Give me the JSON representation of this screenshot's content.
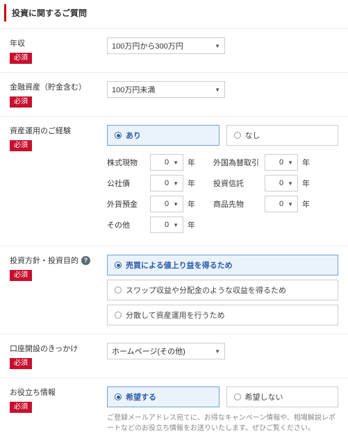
{
  "section_title": "投資に関するご質問",
  "required_label": "必須",
  "year_unit": "年",
  "annual_income": {
    "label": "年収",
    "value": "100万円から300万円"
  },
  "financial_assets": {
    "label": "金融資産（貯金含む）",
    "value": "100万円未満"
  },
  "experience": {
    "label": "資産運用のご経験",
    "option_yes": "あり",
    "option_no": "なし",
    "items": [
      {
        "label": "株式現物",
        "value": "0"
      },
      {
        "label": "公社債",
        "value": "0"
      },
      {
        "label": "外貨預金",
        "value": "0"
      },
      {
        "label": "その他",
        "value": "0"
      }
    ],
    "items_right": [
      {
        "label": "外国為替取引",
        "value": "0"
      },
      {
        "label": "投資信託",
        "value": "0"
      },
      {
        "label": "商品先物",
        "value": "0"
      }
    ]
  },
  "policy": {
    "label": "投資方針・投資目的",
    "options": [
      "売買による値上り益を得るため",
      "スワップ収益や分配金のような収益を得るため",
      "分散して資産運用を行うため"
    ],
    "selected_index": 0
  },
  "trigger": {
    "label": "口座開設のきっかけ",
    "value": "ホームページ(その他)"
  },
  "useful_info": {
    "label": "お役立ち情報",
    "option_yes": "希望する",
    "option_no": "希望しない",
    "note": "ご登録メールアドレス宛てに、お得なキャンペーン情報や、相場解説レポートなどのお役立ち情報をお送りいたします。ぜひご覧ください。"
  }
}
